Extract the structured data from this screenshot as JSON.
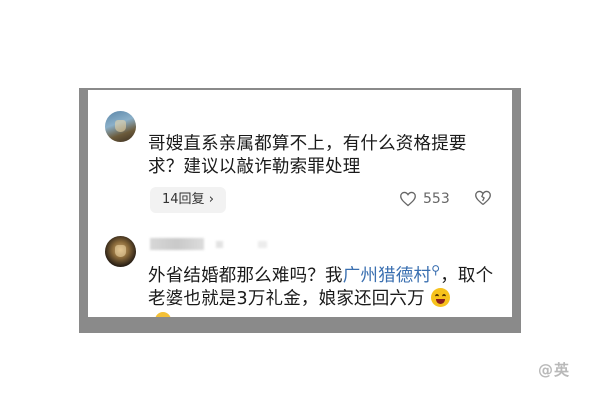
{
  "comments": [
    {
      "text": "哥嫂直系亲属都算不上，有什么资格提要求？建议以敲诈勒索罪处理",
      "reply_label": "14回复",
      "reply_chevron": "›",
      "likes": "553"
    },
    {
      "text_before_link": "外省结婚都那么难吗？我",
      "link_text": "广州猎德村",
      "link_icon": "location-pin-icon",
      "text_after_link": "，取个老婆也就是3万礼金，娘家还回六万",
      "emoji": "laughing-crying-emoji"
    }
  ],
  "watermark": "@英"
}
